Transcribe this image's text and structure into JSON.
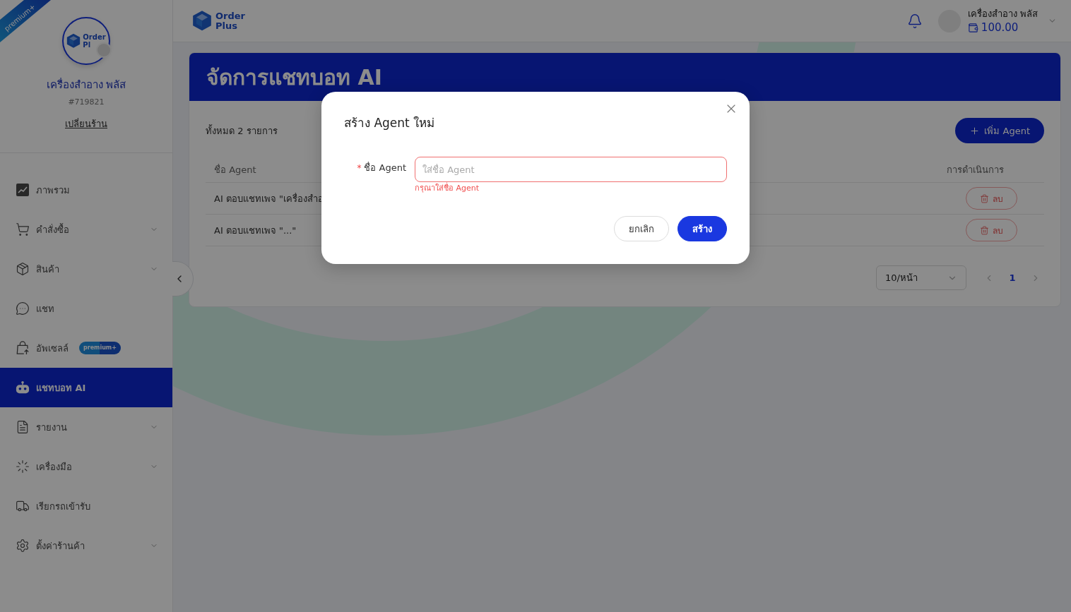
{
  "sidebar": {
    "ribbon": "premium+",
    "shop_logo": {
      "line_1": "Order",
      "line_2": "Pl"
    },
    "shop_name": "เครื่องสำอาง พลัส",
    "shop_id": "#719821",
    "switch_shop": "เปลี่ยนร้าน",
    "menu": [
      {
        "label": "ภาพรวม",
        "has_submenu": false,
        "selected": false
      },
      {
        "label": "คำสั่งซื้อ",
        "has_submenu": true,
        "selected": false
      },
      {
        "label": "สินค้า",
        "has_submenu": true,
        "selected": false
      },
      {
        "label": "แชท",
        "has_submenu": false,
        "selected": false
      },
      {
        "label": "อัพเซลล์",
        "has_submenu": false,
        "selected": false,
        "badge": "premium+"
      },
      {
        "label": "แชทบอท AI",
        "has_submenu": false,
        "selected": true
      },
      {
        "label": "รายงาน",
        "has_submenu": true,
        "selected": false
      },
      {
        "label": "เครื่องมือ",
        "has_submenu": true,
        "selected": false
      },
      {
        "label": "เรียกรถเข้ารับ",
        "has_submenu": false,
        "selected": false
      },
      {
        "label": "ตั้งค่าร้านค้า",
        "has_submenu": true,
        "selected": false
      }
    ]
  },
  "header": {
    "logo": {
      "line_1": "Order",
      "line_2": "Plus"
    },
    "user_name": "เครื่องสำอาง พลัส",
    "balance": "100.00"
  },
  "page": {
    "title": "จัดการแชทบอท AI",
    "total": "ทั้งหมด 2 รายการ",
    "add_button": "เพิ่ม Agent",
    "table": {
      "columns": [
        "ชื่อ Agent",
        "การดำเนินการ"
      ],
      "rows": [
        {
          "name": "AI ตอบแชทเพจ \"เครื่องสำอ",
          "action": "ลบ"
        },
        {
          "name": "AI ตอบแชทเพจ \"...\"",
          "action": "ลบ"
        }
      ]
    },
    "pagination": {
      "page_size": "10/หน้า",
      "pages": [
        {
          "label": "1",
          "selected": true
        }
      ]
    }
  },
  "modal": {
    "title": "สร้าง Agent ใหม่",
    "field": {
      "required_mark": "*",
      "label": "ชื่อ Agent",
      "placeholder": "ใส่ชื่อ Agent",
      "invalid": true,
      "error": "กรุณาใส่ชื่อ Agent"
    },
    "buttons": [
      {
        "label": "ยกเลิก",
        "kind": "secondary"
      },
      {
        "label": "สร้าง",
        "kind": "primary"
      }
    ]
  }
}
